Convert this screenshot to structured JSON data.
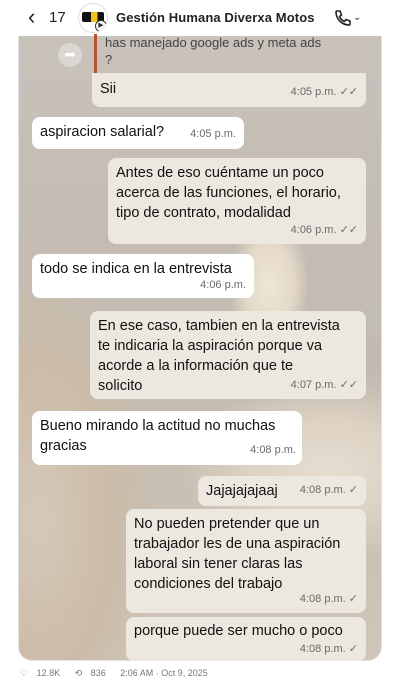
{
  "header": {
    "back_count": "17",
    "title": "Gestión Humana Diverxa Motos"
  },
  "quoted": {
    "text_line1": "has manejado google ads y meta ads",
    "text_line2": "?"
  },
  "messages": [
    {
      "dir": "out",
      "lines": [
        "Sii"
      ],
      "time": "4:05 p.m.",
      "ticks": "✓✓"
    },
    {
      "dir": "in",
      "lines": [
        "aspiracion salarial?"
      ],
      "time": "4:05 p.m."
    },
    {
      "dir": "out",
      "lines": [
        "Antes de eso cuéntame un poco",
        "acerca de las funciones, el horario,",
        "tipo de contrato, modalidad"
      ],
      "time": "4:06 p.m.",
      "ticks": "✓✓"
    },
    {
      "dir": "in",
      "lines": [
        "todo se indica en la entrevista"
      ],
      "time": "4:06 p.m."
    },
    {
      "dir": "out",
      "lines": [
        "En ese caso, tambien en la entrevista",
        "te indicaria la aspiración porque va",
        "acorde a la información que te",
        "solicito"
      ],
      "time": "4:07 p.m.",
      "ticks": "✓✓"
    },
    {
      "dir": "in",
      "lines": [
        "Bueno mirando la actitud no muchas",
        "gracias"
      ],
      "time": "4:08 p.m."
    },
    {
      "dir": "out",
      "lines": [
        "Jajajajajaaj"
      ],
      "time": "4:08 p.m.",
      "ticks": "✓"
    },
    {
      "dir": "out",
      "lines": [
        "No pueden pretender que un",
        "trabajador les de una aspiración",
        "laboral sin tener claras las",
        "condiciones del trabajo"
      ],
      "time": "4:08 p.m.",
      "ticks": "✓"
    },
    {
      "dir": "out",
      "lines": [
        "porque puede ser mucho o poco"
      ],
      "time": "4:08 p.m.",
      "ticks": "✓"
    }
  ],
  "footer": {
    "likes": "12.8K",
    "reposts": "836",
    "timestamp": "2:06 AM · Oct 9, 2025"
  },
  "icons": {
    "back": "chevron-left-icon",
    "call": "phone-icon",
    "forward": "forward-icon"
  }
}
